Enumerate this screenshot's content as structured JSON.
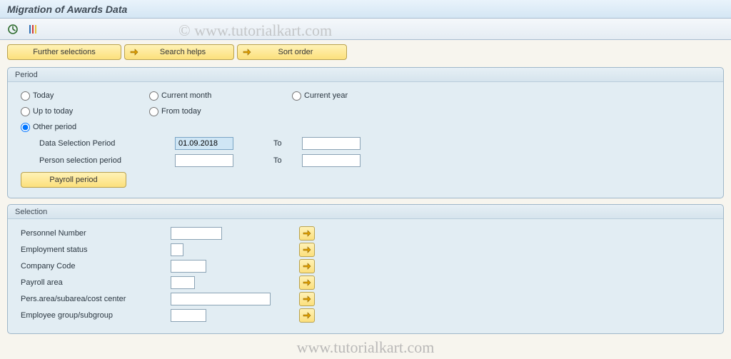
{
  "title": "Migration of Awards Data",
  "watermark_top": "© www.tutorialkart.com",
  "watermark_bottom": "www.tutorialkart.com",
  "toolbar": {
    "further_selections": "Further selections",
    "search_helps": "Search helps",
    "sort_order": "Sort order"
  },
  "period": {
    "legend": "Period",
    "today": "Today",
    "up_to_today": "Up to today",
    "other_period": "Other period",
    "current_month": "Current month",
    "from_today": "From today",
    "current_year": "Current year",
    "selected": "other_period",
    "data_selection_label": "Data Selection Period",
    "data_selection_from": "01.09.2018",
    "data_selection_to": "",
    "person_selection_label": "Person selection period",
    "person_selection_from": "",
    "person_selection_to": "",
    "to_label": "To",
    "payroll_period": "Payroll period"
  },
  "selection": {
    "legend": "Selection",
    "fields": {
      "personnel_number": {
        "label": "Personnel Number",
        "value": ""
      },
      "employment_status": {
        "label": "Employment status",
        "value": ""
      },
      "company_code": {
        "label": "Company Code",
        "value": ""
      },
      "payroll_area": {
        "label": "Payroll area",
        "value": ""
      },
      "pers_area": {
        "label": "Pers.area/subarea/cost center",
        "value": ""
      },
      "employee_group": {
        "label": "Employee group/subgroup",
        "value": ""
      }
    }
  }
}
